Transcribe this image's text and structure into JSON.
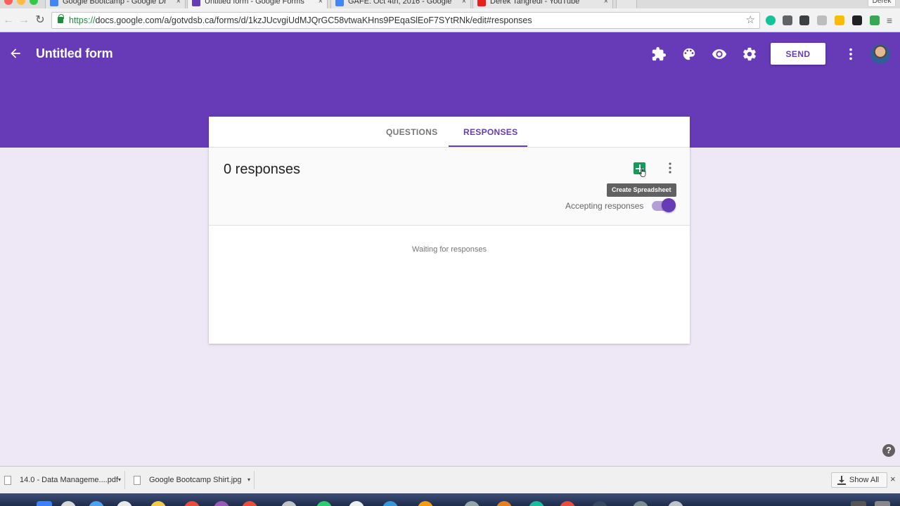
{
  "browser": {
    "tabs": [
      {
        "title": "Google Bootcamp - Google Dr",
        "active": false
      },
      {
        "title": "Untitled form - Google Forms",
        "active": true
      },
      {
        "title": "GAFE: Oct 4th, 2016 - Google",
        "active": false
      },
      {
        "title": "Derek Tangredi - YouTube",
        "active": false
      }
    ],
    "tab_close": "×",
    "profile_label": "Derek",
    "url_secure": "https://",
    "url_rest": "docs.google.com/a/gotvdsb.ca/forms/d/1kzJUcvgiUdMJQrGC58vtwaKHns9PEqaSlEoF7SYtRNk/edit#responses",
    "star": "☆",
    "back": "←",
    "forward": "→",
    "reload": "↻"
  },
  "header": {
    "title": "Untitled form",
    "send_label": "SEND",
    "brand_color": "#673ab7"
  },
  "card": {
    "tabs": {
      "questions": "QUESTIONS",
      "responses": "RESPONSES"
    },
    "response_count": "0 responses",
    "tooltip": "Create Spreadsheet",
    "accepting_label": "Accepting responses",
    "accepting": true,
    "waiting": "Waiting for responses"
  },
  "help_label": "?",
  "downloads": {
    "items": [
      {
        "name": "14.0 - Data Manageme....pdf"
      },
      {
        "name": "Google Bootcamp Shirt.jpg"
      }
    ],
    "dropdown": "▾",
    "show_all": "Show All",
    "close": "×"
  }
}
